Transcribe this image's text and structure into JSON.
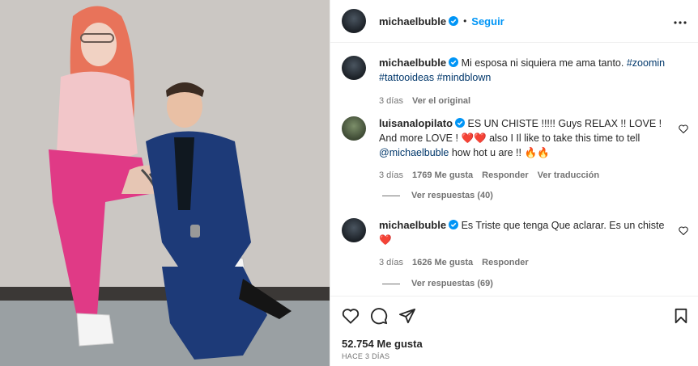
{
  "post": {
    "author": "michaelbuble",
    "follow_label": "Seguir",
    "dot": "•",
    "caption_author": "michaelbuble",
    "caption_text": "Mi esposa ni siquiera me ama tanto.",
    "caption_tags": [
      "#zoomin",
      "#tattooideas",
      "#mindblown"
    ],
    "caption_time": "3 días",
    "caption_see_original": "Ver el original"
  },
  "comments": [
    {
      "author": "luisanalopilato",
      "text_part1": "ES UN CHISTE !!!!! Guys RELAX !! LOVE ! And more LOVE !",
      "text_emoji1": "❤️❤️",
      "text_part2": "also I Il like to take this time to tell",
      "mention": "@michaelbuble",
      "text_part3": "how hot u are !!",
      "text_emoji2": "🔥🔥",
      "time": "3 días",
      "likes": "1769 Me gusta",
      "reply": "Responder",
      "translate": "Ver traducción",
      "view_replies": "Ver respuestas (40)"
    },
    {
      "author": "michaelbuble",
      "text_part1": "Es Triste que tenga Que aclarar. Es un chiste",
      "text_emoji1": "❤️",
      "time": "3 días",
      "likes": "1626 Me gusta",
      "reply": "Responder",
      "view_replies": "Ver respuestas (69)"
    }
  ],
  "footer": {
    "likes": "52.754 Me gusta",
    "ago": "HACE 3 DÍAS"
  },
  "colors": {
    "link": "#0095f6",
    "tag": "#00376b",
    "verified": "#0095f6",
    "muted": "#737373"
  },
  "icons": [
    "verified-badge-icon",
    "more-options-icon",
    "heart-icon",
    "comment-icon",
    "share-icon",
    "save-icon"
  ]
}
